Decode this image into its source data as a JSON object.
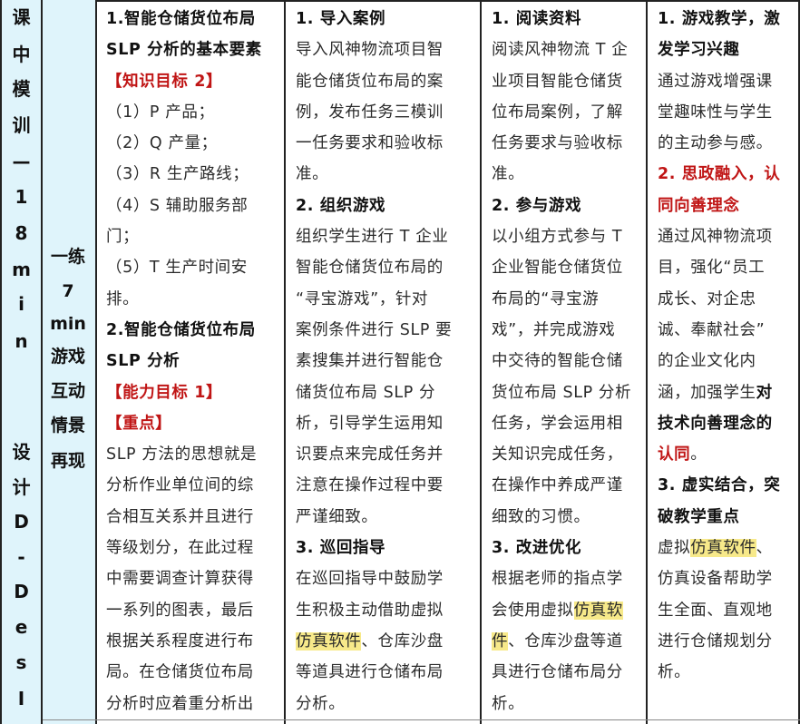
{
  "col1": [
    "课",
    "中",
    "模",
    "训",
    "—",
    "1",
    "8",
    "m",
    "i",
    "n",
    "设",
    "计",
    "D",
    "-",
    "D",
    "e",
    "s",
    "I"
  ],
  "col2": [
    "一练",
    "7",
    "min",
    "游戏",
    "互动",
    "情景",
    "再现"
  ],
  "col3": [
    {
      "t": "1.智能仓储货位布局",
      "s": "hd"
    },
    {
      "t": "SLP 分析的基本要素",
      "s": "hd"
    },
    {
      "t": "【知识目标 2】",
      "s": "red"
    },
    {
      "t": "（1）P 产品；",
      "s": ""
    },
    {
      "t": "（2）Q 产量；",
      "s": ""
    },
    {
      "t": "（3）R 生产路线；",
      "s": ""
    },
    {
      "t": "（4）S 辅助服务部",
      "s": ""
    },
    {
      "t": "门；",
      "s": ""
    },
    {
      "t": "（5）T 生产时间安",
      "s": ""
    },
    {
      "t": "排。",
      "s": ""
    },
    {
      "t": "2.智能仓储货位布局",
      "s": "hd"
    },
    {
      "t": "SLP 分析",
      "s": "hd"
    },
    {
      "t": "【能力目标 1】",
      "s": "red"
    },
    {
      "t": "【重点】",
      "s": "red"
    },
    {
      "t": "SLP 方法的思想就是",
      "s": ""
    },
    {
      "t": "分析作业单位间的综",
      "s": ""
    },
    {
      "t": "合相互关系并且进行",
      "s": ""
    },
    {
      "t": "等级划分，在此过程",
      "s": ""
    },
    {
      "t": "中需要调查计算获得",
      "s": ""
    },
    {
      "t": "一系列的图表，最后",
      "s": ""
    },
    {
      "t": "根据关系程度进行布",
      "s": ""
    },
    {
      "t": "局。在仓储货位布局",
      "s": ""
    },
    {
      "t": "分析时应着重分析出",
      "s": ""
    }
  ],
  "col4": [
    [
      {
        "t": "1. 导入案例",
        "s": "hd"
      }
    ],
    [
      {
        "t": "导入风神物流项目智",
        "s": ""
      }
    ],
    [
      {
        "t": "能仓储货位布局的案",
        "s": ""
      }
    ],
    [
      {
        "t": "例，发布任务三模训",
        "s": ""
      }
    ],
    [
      {
        "t": "一任务要求和验收标",
        "s": ""
      }
    ],
    [
      {
        "t": "准。",
        "s": ""
      }
    ],
    [
      {
        "t": "2. 组织游戏",
        "s": "hd"
      }
    ],
    [
      {
        "t": "组织学生进行 T 企业",
        "s": ""
      }
    ],
    [
      {
        "t": "智能仓储货位布局的",
        "s": ""
      }
    ],
    [
      {
        "t": "“寻宝游戏”，针对",
        "s": ""
      }
    ],
    [
      {
        "t": "案例条件进行 SLP 要",
        "s": ""
      }
    ],
    [
      {
        "t": "素搜集并进行智能仓",
        "s": ""
      }
    ],
    [
      {
        "t": "储货位布局 SLP 分",
        "s": ""
      }
    ],
    [
      {
        "t": "析，引导学生运用知",
        "s": ""
      }
    ],
    [
      {
        "t": "识要点来完成任务并",
        "s": ""
      }
    ],
    [
      {
        "t": "注意在操作过程中要",
        "s": ""
      }
    ],
    [
      {
        "t": "严谨细致。",
        "s": ""
      }
    ],
    [
      {
        "t": "3. 巡回指导",
        "s": "hd"
      }
    ],
    [
      {
        "t": "在巡回指导中鼓励学",
        "s": ""
      }
    ],
    [
      {
        "t": "生积极主动借助虚拟",
        "s": ""
      }
    ],
    [
      {
        "t": "仿真软件",
        "s": "hl"
      },
      {
        "t": "、仓库沙盘",
        "s": ""
      }
    ],
    [
      {
        "t": "等道具进行仓储布局",
        "s": ""
      }
    ],
    [
      {
        "t": "分析。",
        "s": ""
      }
    ]
  ],
  "col5": [
    [
      {
        "t": "1. 阅读资料",
        "s": "hd"
      }
    ],
    [
      {
        "t": "阅读风神物流 T 企",
        "s": ""
      }
    ],
    [
      {
        "t": "业项目智能仓储货",
        "s": ""
      }
    ],
    [
      {
        "t": "位布局案例，了解",
        "s": ""
      }
    ],
    [
      {
        "t": "任务要求与验收标",
        "s": ""
      }
    ],
    [
      {
        "t": "准。",
        "s": ""
      }
    ],
    [
      {
        "t": "2. 参与游戏",
        "s": "hd"
      }
    ],
    [
      {
        "t": "以小组方式参与 T",
        "s": ""
      }
    ],
    [
      {
        "t": "企业智能仓储货位",
        "s": ""
      }
    ],
    [
      {
        "t": "布局的“寻宝游",
        "s": ""
      }
    ],
    [
      {
        "t": "戏”，并完成游戏",
        "s": ""
      }
    ],
    [
      {
        "t": "中交待的智能仓储",
        "s": ""
      }
    ],
    [
      {
        "t": "货位布局 SLP 分析",
        "s": ""
      }
    ],
    [
      {
        "t": "任务，学会运用相",
        "s": ""
      }
    ],
    [
      {
        "t": "关知识完成任务，",
        "s": ""
      }
    ],
    [
      {
        "t": "在操作中养成严谨",
        "s": ""
      }
    ],
    [
      {
        "t": "细致的习惯。",
        "s": ""
      }
    ],
    [
      {
        "t": "3. 改进优化",
        "s": "hd"
      }
    ],
    [
      {
        "t": "根据老师的指点学",
        "s": ""
      }
    ],
    [
      {
        "t": "会使用虚拟",
        "s": ""
      },
      {
        "t": "仿真软",
        "s": "hl"
      }
    ],
    [
      {
        "t": "件",
        "s": "hl"
      },
      {
        "t": "、仓库沙盘等道",
        "s": ""
      }
    ],
    [
      {
        "t": "具进行仓储布局分",
        "s": ""
      }
    ],
    [
      {
        "t": "析。",
        "s": ""
      }
    ]
  ],
  "col6": [
    [
      {
        "t": "1. 游戏教学，激",
        "s": "hd"
      }
    ],
    [
      {
        "t": "发学习兴趣",
        "s": "hd"
      }
    ],
    [
      {
        "t": "通过游戏增强课",
        "s": ""
      }
    ],
    [
      {
        "t": "堂趣味性与学生",
        "s": ""
      }
    ],
    [
      {
        "t": "的主动参与感。",
        "s": ""
      }
    ],
    [
      {
        "t": "2. 思政融入，认",
        "s": "red"
      }
    ],
    [
      {
        "t": "同向善理念",
        "s": "red"
      }
    ],
    [
      {
        "t": "通过风神物流项",
        "s": ""
      }
    ],
    [
      {
        "t": "目，强化“员工",
        "s": ""
      }
    ],
    [
      {
        "t": "成长、对企忠",
        "s": ""
      }
    ],
    [
      {
        "t": "诚、奉献社会”",
        "s": ""
      }
    ],
    [
      {
        "t": "的企业文化内",
        "s": ""
      }
    ],
    [
      {
        "t": "涵，加强学生",
        "s": ""
      },
      {
        "t": "对",
        "s": "hd"
      }
    ],
    [
      {
        "t": "技术向善理念的",
        "s": "hd"
      }
    ],
    [
      {
        "t": "认同",
        "s": "red"
      },
      {
        "t": "。",
        "s": ""
      }
    ],
    [
      {
        "t": "3. 虚实结合，突",
        "s": "hd"
      }
    ],
    [
      {
        "t": "破教学重点",
        "s": "hd"
      }
    ],
    [
      {
        "t": "虚拟",
        "s": ""
      },
      {
        "t": "仿真软件",
        "s": "hl"
      },
      {
        "t": "、",
        "s": ""
      }
    ],
    [
      {
        "t": "仿真设备帮助学",
        "s": ""
      }
    ],
    [
      {
        "t": "生全面、直观地",
        "s": ""
      }
    ],
    [
      {
        "t": "进行仓储规划分",
        "s": ""
      }
    ],
    [
      {
        "t": "析。",
        "s": ""
      }
    ]
  ]
}
